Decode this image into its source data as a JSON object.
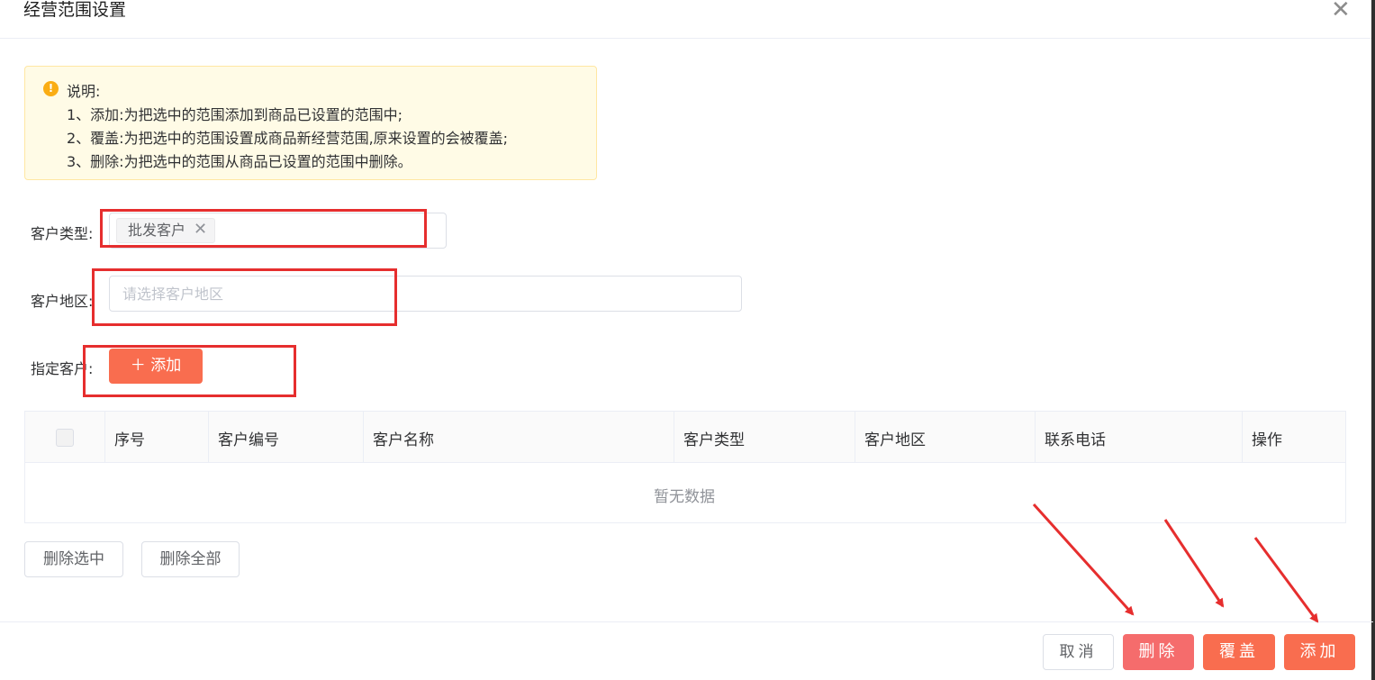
{
  "dialog": {
    "title": "经营范围设置",
    "close_icon": "close-icon"
  },
  "notice": {
    "icon": "warning-icon",
    "heading": "说明:",
    "lines": [
      "1、添加:为把选中的范围添加到商品已设置的范围中;",
      "2、覆盖:为把选中的范围设置成商品新经营范围,原来设置的会被覆盖;",
      "3、删除:为把选中的范围从商品已设置的范围中删除。"
    ]
  },
  "form": {
    "customer_type": {
      "label": "客户类型:",
      "selected_tag": "批发客户"
    },
    "customer_region": {
      "label": "客户地区:",
      "placeholder": "请选择客户地区",
      "value": ""
    },
    "specified_customer": {
      "label": "指定客户:",
      "add_button": "添加",
      "add_icon": "plus-icon"
    }
  },
  "table": {
    "columns": [
      "序号",
      "客户编号",
      "客户名称",
      "客户类型",
      "客户地区",
      "联系电话",
      "操作"
    ],
    "rows": [],
    "empty_text": "暂无数据"
  },
  "table_actions": {
    "delete_selected": "删除选中",
    "delete_all": "删除全部"
  },
  "footer": {
    "cancel": "取消",
    "delete": "删除",
    "cover": "覆盖",
    "add": "添加"
  },
  "colors": {
    "primary": "#f96d4f",
    "danger": "#f56c6c",
    "warning_bg": "#fffbe6",
    "annotation": "#e62e2e"
  }
}
